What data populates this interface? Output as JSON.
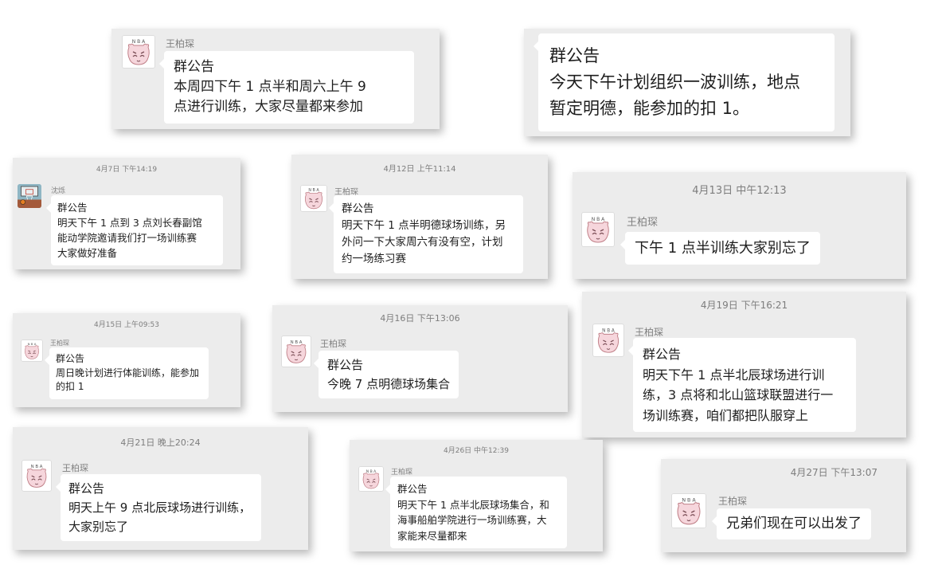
{
  "cards": [
    {
      "id": "c1",
      "timestamp": "",
      "sender": "王柏琛",
      "avatar": "pig-avatar",
      "lines": [
        "群公告",
        "本周四下午 1 点半和周六上午 9",
        "点进行训练，大家尽量都来参加"
      ]
    },
    {
      "id": "c2",
      "timestamp": "",
      "sender": "",
      "avatar": "",
      "lines": [
        "群公告",
        "今天下午计划组织一波训练，地点",
        "暂定明德，能参加的扣 1。"
      ]
    },
    {
      "id": "c3",
      "timestamp": "4月7日 下午14:19",
      "sender": "沈烁",
      "avatar": "basketball-avatar",
      "lines": [
        "群公告",
        "明天下午 1 点到 3 点刘长春副馆",
        "能动学院邀请我们打一场训练赛",
        "大家做好准备"
      ]
    },
    {
      "id": "c4",
      "timestamp": "4月12日 上午11:14",
      "sender": "王柏琛",
      "avatar": "pig-avatar",
      "lines": [
        "群公告",
        "明天下午 1 点半明德球场训练，另",
        "外问一下大家周六有没有空，计划",
        "约一场练习赛"
      ]
    },
    {
      "id": "c5",
      "timestamp": "4月13日 中午12:13",
      "sender": "王柏琛",
      "avatar": "pig-avatar",
      "lines": [
        "下午 1 点半训练大家别忘了"
      ]
    },
    {
      "id": "c6",
      "timestamp": "4月15日 上午09:53",
      "sender": "王柏琛",
      "avatar": "pig-avatar",
      "lines": [
        "群公告",
        "周日晚计划进行体能训练，能参加",
        "的扣 1"
      ]
    },
    {
      "id": "c7",
      "timestamp": "4月16日 下午13:06",
      "sender": "王柏琛",
      "avatar": "pig-avatar",
      "lines": [
        "群公告",
        "今晚 7 点明德球场集合"
      ]
    },
    {
      "id": "c8",
      "timestamp": "4月19日 下午16:21",
      "sender": "王柏琛",
      "avatar": "pig-avatar",
      "lines": [
        "群公告",
        "明天下午 1 点半北辰球场进行训",
        "练，3 点将和北山篮球联盟进行一",
        "场训练赛，咱们都把队服穿上"
      ]
    },
    {
      "id": "c9",
      "timestamp": "4月21日 晚上20:24",
      "sender": "王柏琛",
      "avatar": "pig-avatar",
      "lines": [
        "群公告",
        "明天上午 9 点北辰球场进行训练，",
        "大家别忘了"
      ]
    },
    {
      "id": "c10",
      "timestamp": "4月26日 中午12:39",
      "sender": "王柏琛",
      "avatar": "pig-avatar",
      "lines": [
        "群公告",
        "明天下午 1 点半北辰球场集合，和",
        "海事船舶学院进行一场训练赛，大",
        "家能来尽量都来"
      ]
    },
    {
      "id": "c11",
      "timestamp": "4月27日 下午13:07",
      "sender": "王柏琛",
      "avatar": "pig-avatar",
      "lines": [
        "兄弟们现在可以出发了"
      ]
    }
  ],
  "avatar_label": "N B A"
}
